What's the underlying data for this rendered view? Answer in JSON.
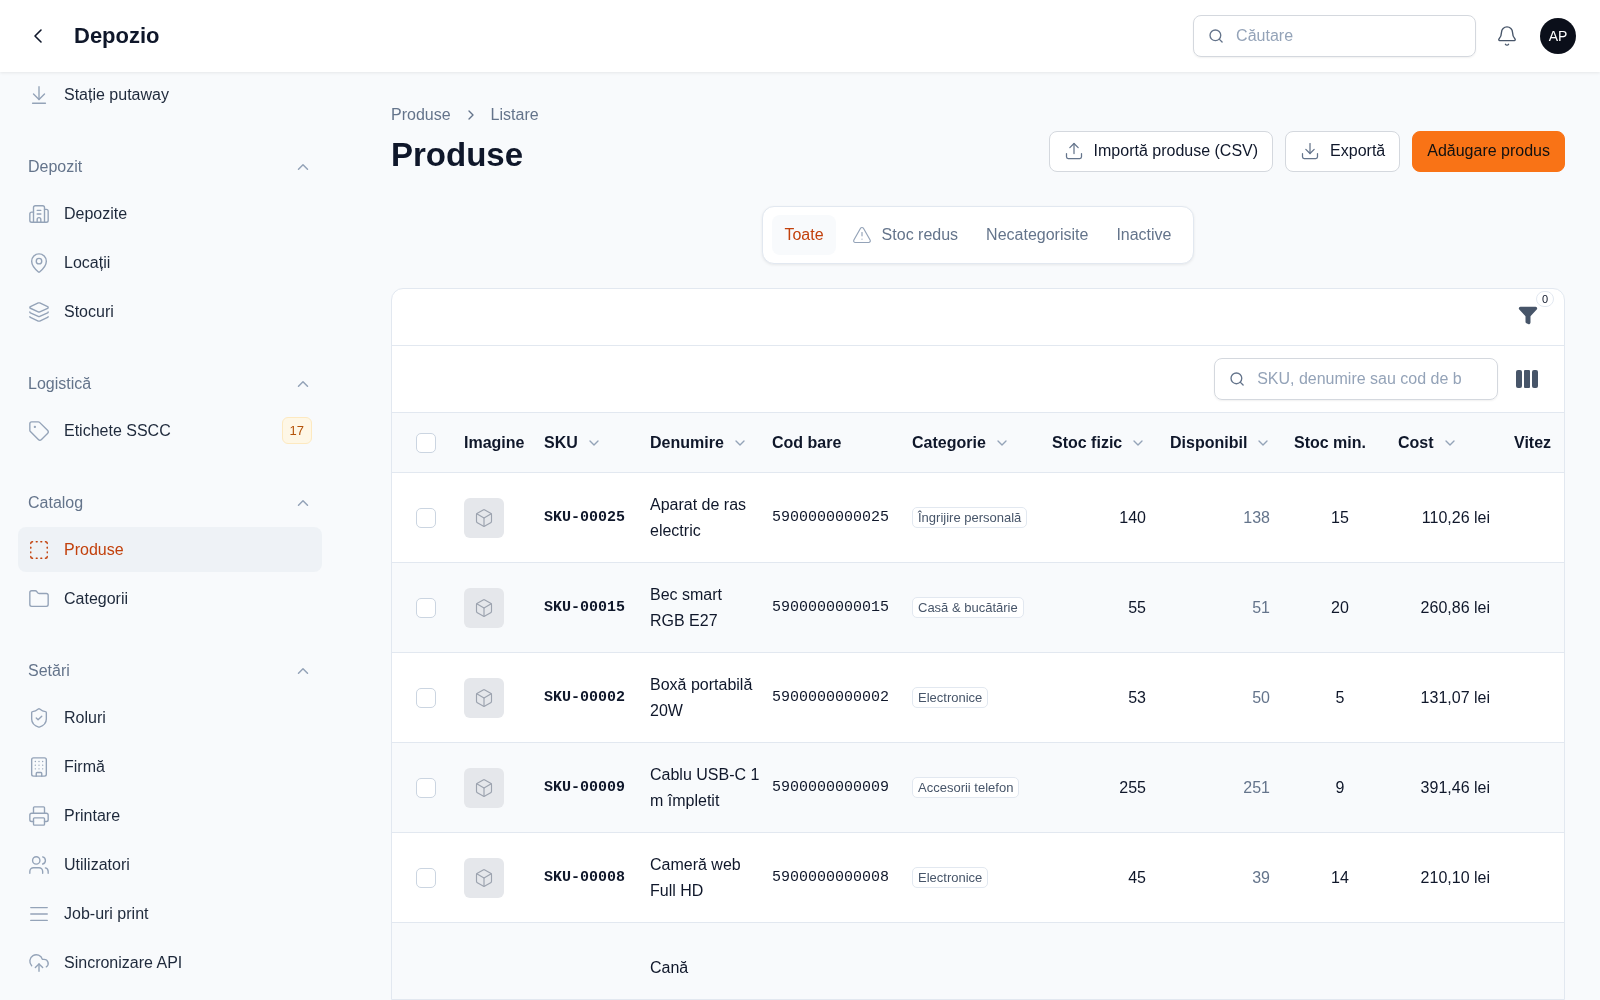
{
  "header": {
    "title": "Depozio",
    "search_placeholder": "Căutare",
    "avatar": "AP"
  },
  "sidebar": {
    "top_items": [
      {
        "label": "Stație putaway"
      }
    ],
    "sections": [
      {
        "title": "Depozit",
        "expanded": true,
        "items": [
          {
            "label": "Depozite",
            "selected": false
          },
          {
            "label": "Locații",
            "selected": false
          },
          {
            "label": "Stocuri",
            "selected": false
          }
        ]
      },
      {
        "title": "Logistică",
        "expanded": true,
        "items": [
          {
            "label": "Etichete SSCC",
            "selected": false,
            "badge": "17"
          }
        ]
      },
      {
        "title": "Catalog",
        "expanded": true,
        "items": [
          {
            "label": "Produse",
            "selected": true
          },
          {
            "label": "Categorii",
            "selected": false
          }
        ]
      },
      {
        "title": "Setări",
        "expanded": true,
        "items": [
          {
            "label": "Roluri",
            "selected": false
          },
          {
            "label": "Firmă",
            "selected": false
          },
          {
            "label": "Printare",
            "selected": false
          },
          {
            "label": "Utilizatori",
            "selected": false
          },
          {
            "label": "Job-uri print",
            "selected": false
          },
          {
            "label": "Sincronizare API",
            "selected": false
          }
        ]
      }
    ]
  },
  "breadcrumb": [
    "Produse",
    "Listare"
  ],
  "title": "Produse",
  "actions": [
    {
      "label": "Importă produse (CSV)",
      "kind": "import"
    },
    {
      "label": "Exportă",
      "kind": "export"
    },
    {
      "label": "Adăugare produs",
      "kind": "primary"
    }
  ],
  "tabs": [
    {
      "label": "Toate",
      "selected": true,
      "kind": "plain"
    },
    {
      "label": "Stoc redus",
      "selected": false,
      "kind": "warning"
    },
    {
      "label": "Necategorisite",
      "selected": false,
      "kind": "plain"
    },
    {
      "label": "Inactive",
      "selected": false,
      "kind": "plain"
    }
  ],
  "filter_count": "0",
  "select_all_checked": false,
  "table_search_placeholder": "SKU, denumire sau cod de b",
  "columns": [
    {
      "label": "Imagine",
      "sortable": false
    },
    {
      "label": "SKU",
      "sortable": true
    },
    {
      "label": "Denumire",
      "sortable": true
    },
    {
      "label": "Cod bare",
      "sortable": false
    },
    {
      "label": "Categorie",
      "sortable": true
    },
    {
      "label": "Stoc fizic",
      "sortable": true
    },
    {
      "label": "Disponibil",
      "sortable": true
    },
    {
      "label": "Stoc min.",
      "sortable": false
    },
    {
      "label": "Cost",
      "sortable": true
    },
    {
      "label": "Vitez",
      "sortable": false
    }
  ],
  "rows": [
    {
      "checked": false,
      "sku": "SKU-00025",
      "name": "Aparat de ras electric",
      "barcode": "5900000000025",
      "category": "Îngrijire personală",
      "stock": "140",
      "available": "138",
      "min": "15",
      "cost": "110,26 lei"
    },
    {
      "checked": false,
      "sku": "SKU-00015",
      "name": "Bec smart RGB E27",
      "barcode": "5900000000015",
      "category": "Casă & bucătărie",
      "stock": "55",
      "available": "51",
      "min": "20",
      "cost": "260,86 lei"
    },
    {
      "checked": false,
      "sku": "SKU-00002",
      "name": "Boxă portabilă 20W",
      "barcode": "5900000000002",
      "category": "Electronice",
      "stock": "53",
      "available": "50",
      "min": "5",
      "cost": "131,07 lei"
    },
    {
      "checked": false,
      "sku": "SKU-00009",
      "name": "Cablu USB-C 1 m împletit",
      "barcode": "5900000000009",
      "category": "Accesorii telefon",
      "stock": "255",
      "available": "251",
      "min": "9",
      "cost": "391,46 lei"
    },
    {
      "checked": false,
      "sku": "SKU-00008",
      "name": "Cameră web Full HD",
      "barcode": "5900000000008",
      "category": "Electronice",
      "stock": "45",
      "available": "39",
      "min": "14",
      "cost": "210,10 lei"
    },
    {
      "name": "Cană"
    }
  ]
}
